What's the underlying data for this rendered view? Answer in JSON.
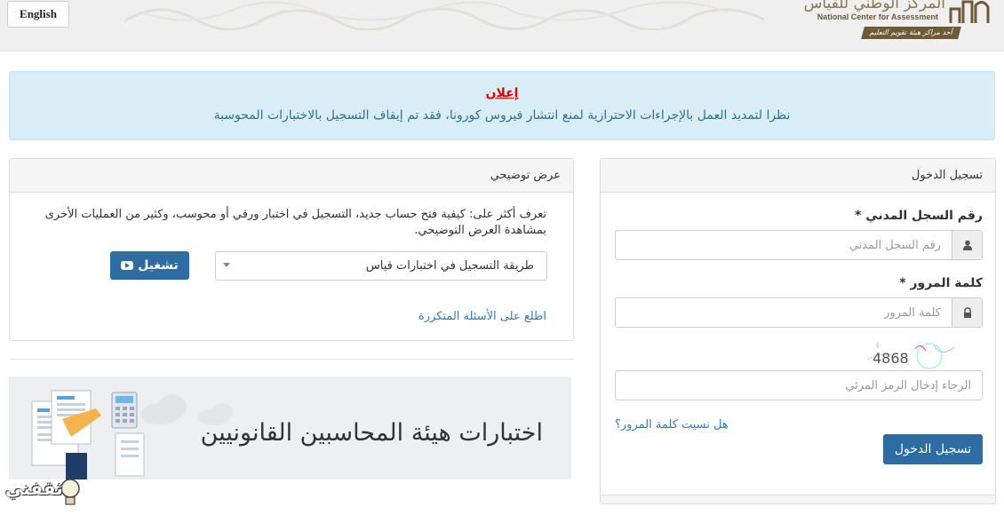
{
  "header": {
    "lang_button": "English",
    "logo": {
      "arabic": "المركز الوطني للقياس",
      "english": "National Center for Assessment",
      "ribbon": "أحد مراكز هيئة تقويم التعليم"
    }
  },
  "alert": {
    "title": "إعلان",
    "message": "نظرا لتمديد العمل بالإجراءات الاحترازية لمنع انتشار فيروس كورونا، فقد تم إيقاف التسجيل بالاختبارات المحوسبة"
  },
  "demo": {
    "heading": "عرض توضيحي",
    "description": "تعرف أكثر على: كيفية فتح حساب جديد، التسجيل في اختبار ورقي أو محوسب، وكثير من العمليات الأخرى بمشاهدة العرض التوضيحي.",
    "select_value": "طريقة التسجيل في اختبارات قياس",
    "play_label": "تشغيل",
    "faq_link": "اطلع على الأسئلة المتكررة"
  },
  "banner": {
    "text": "اختبارات هيئة المحاسبين القانونيين"
  },
  "login": {
    "heading": "تسجيل الدخول",
    "id_label": "رقم السجل المدني *",
    "id_placeholder": "رقم السجل المدني",
    "password_label": "كلمة المرور *",
    "password_placeholder": "كلمة المرور",
    "captcha_text": "4868",
    "captcha_placeholder": "الرجاء إدخال الرمز المرئي",
    "forgot_link": "هل نسيت كلمة المرور؟",
    "submit_label": "تسجيل الدخول"
  },
  "watermark": {
    "text": "ثقفني"
  },
  "colors": {
    "primary": "#2e6da4",
    "alert_bg": "#d9edf7",
    "alert_title": "#e00000",
    "link": "#337ab7",
    "accent_orange": "#f0a31c"
  },
  "icons": {
    "user": "user-icon",
    "lock": "lock-icon",
    "play": "youtube-play-icon",
    "dropdown": "caret-down-icon"
  }
}
